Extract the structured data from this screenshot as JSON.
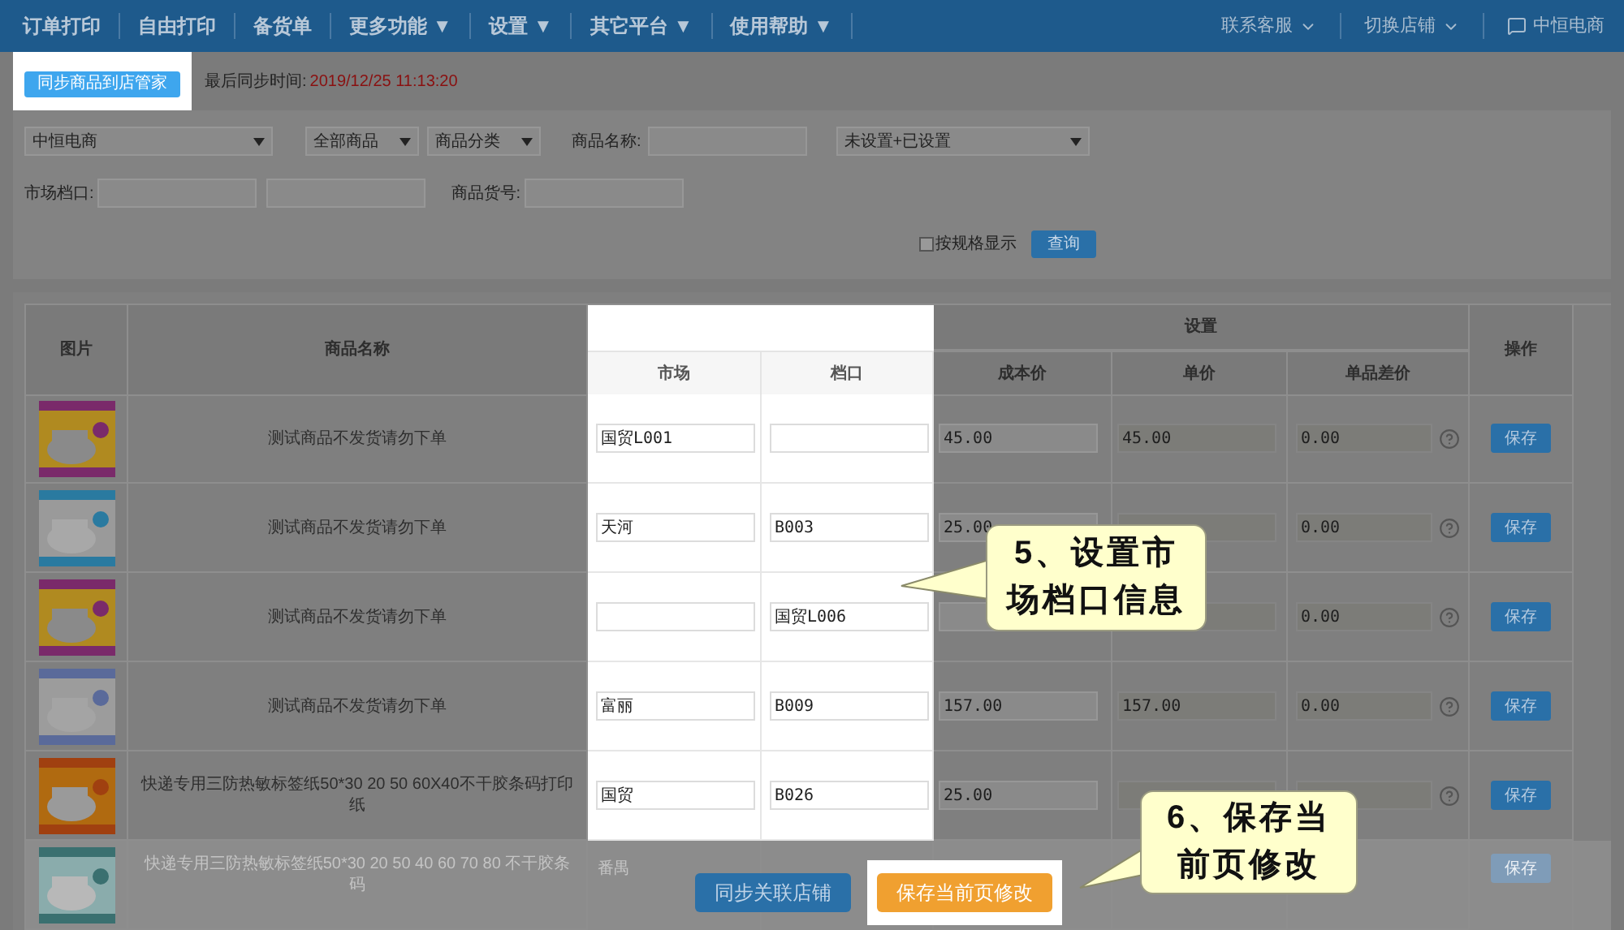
{
  "nav": {
    "items": [
      {
        "label": "订单打印"
      },
      {
        "label": "自由打印"
      },
      {
        "label": "备货单"
      },
      {
        "label": "更多功能",
        "caret": "▼"
      },
      {
        "label": "设置",
        "caret": "▼"
      },
      {
        "label": "其它平台",
        "caret": "▼"
      },
      {
        "label": "使用帮助",
        "caret": "▼"
      }
    ],
    "right": [
      {
        "label": "联系客服",
        "dropdown": true
      },
      {
        "label": "切换店铺",
        "dropdown": true
      },
      {
        "label": "中恒电商",
        "dropdown": false
      }
    ]
  },
  "sync": {
    "button": "同步商品到店管家",
    "highlighted": true,
    "label": "最后同步时间:",
    "time": "2019/12/25 11:13:20"
  },
  "filters": {
    "shop": "中恒电商",
    "scope": "全部商品",
    "category": "商品分类",
    "name_label": "商品名称:",
    "setting": "未设置+已设置",
    "market_label": "市场档口:",
    "sku_label": "商品货号:",
    "spec_checkbox": {
      "label": "按规格显示",
      "checked": false
    },
    "search_button": "查询"
  },
  "table": {
    "headers": {
      "image": "图片",
      "name": "商品名称",
      "group": "设置",
      "market": "市场",
      "stall": "档口",
      "cost": "成本价",
      "price": "单价",
      "diff": "单品差价",
      "action": "操作"
    },
    "market_stall_highlighted": true,
    "rows": [
      {
        "name": "测试商品不发货请勿下单",
        "market": "国贸L001",
        "stall": "",
        "cost": "45.00",
        "price": "45.00",
        "diff": "0.00",
        "action": "保存",
        "obscured": false
      },
      {
        "name": "测试商品不发货请勿下单",
        "market": "天河",
        "stall": "B003",
        "cost": "25.00",
        "diff": "0.00",
        "action": "保存",
        "obscured": false
      },
      {
        "name": "测试商品不发货请勿下单",
        "market": "",
        "stall": "国贸L006",
        "diff": "0.00",
        "action": "保存",
        "obscured": false
      },
      {
        "name": "测试商品不发货请勿下单",
        "market": "富丽",
        "stall": "B009",
        "cost": "157.00",
        "price": "157.00",
        "diff": "0.00",
        "action": "保存",
        "obscured": false
      },
      {
        "name": "快递专用三防热敏标签纸50*30 20 50 60X40不干胶条码打印纸",
        "market": "国贸",
        "stall": "B026",
        "cost": "25.00",
        "action": "保存",
        "obscured": false
      },
      {
        "name": "快递专用三防热敏标签纸50*30 20 50 40 60 70 80 不干胶条码",
        "market": "番禺",
        "action": "保存",
        "obscured": true
      }
    ]
  },
  "footer": {
    "buttons": [
      {
        "label": "同步关联店铺",
        "kind": "primary",
        "highlighted": false
      },
      {
        "label": "保存当前页修改",
        "kind": "warning",
        "highlighted": true
      }
    ]
  },
  "callouts": [
    {
      "text": "5、设置市场档口信息"
    },
    {
      "text": "6、保存当前页修改"
    }
  ]
}
